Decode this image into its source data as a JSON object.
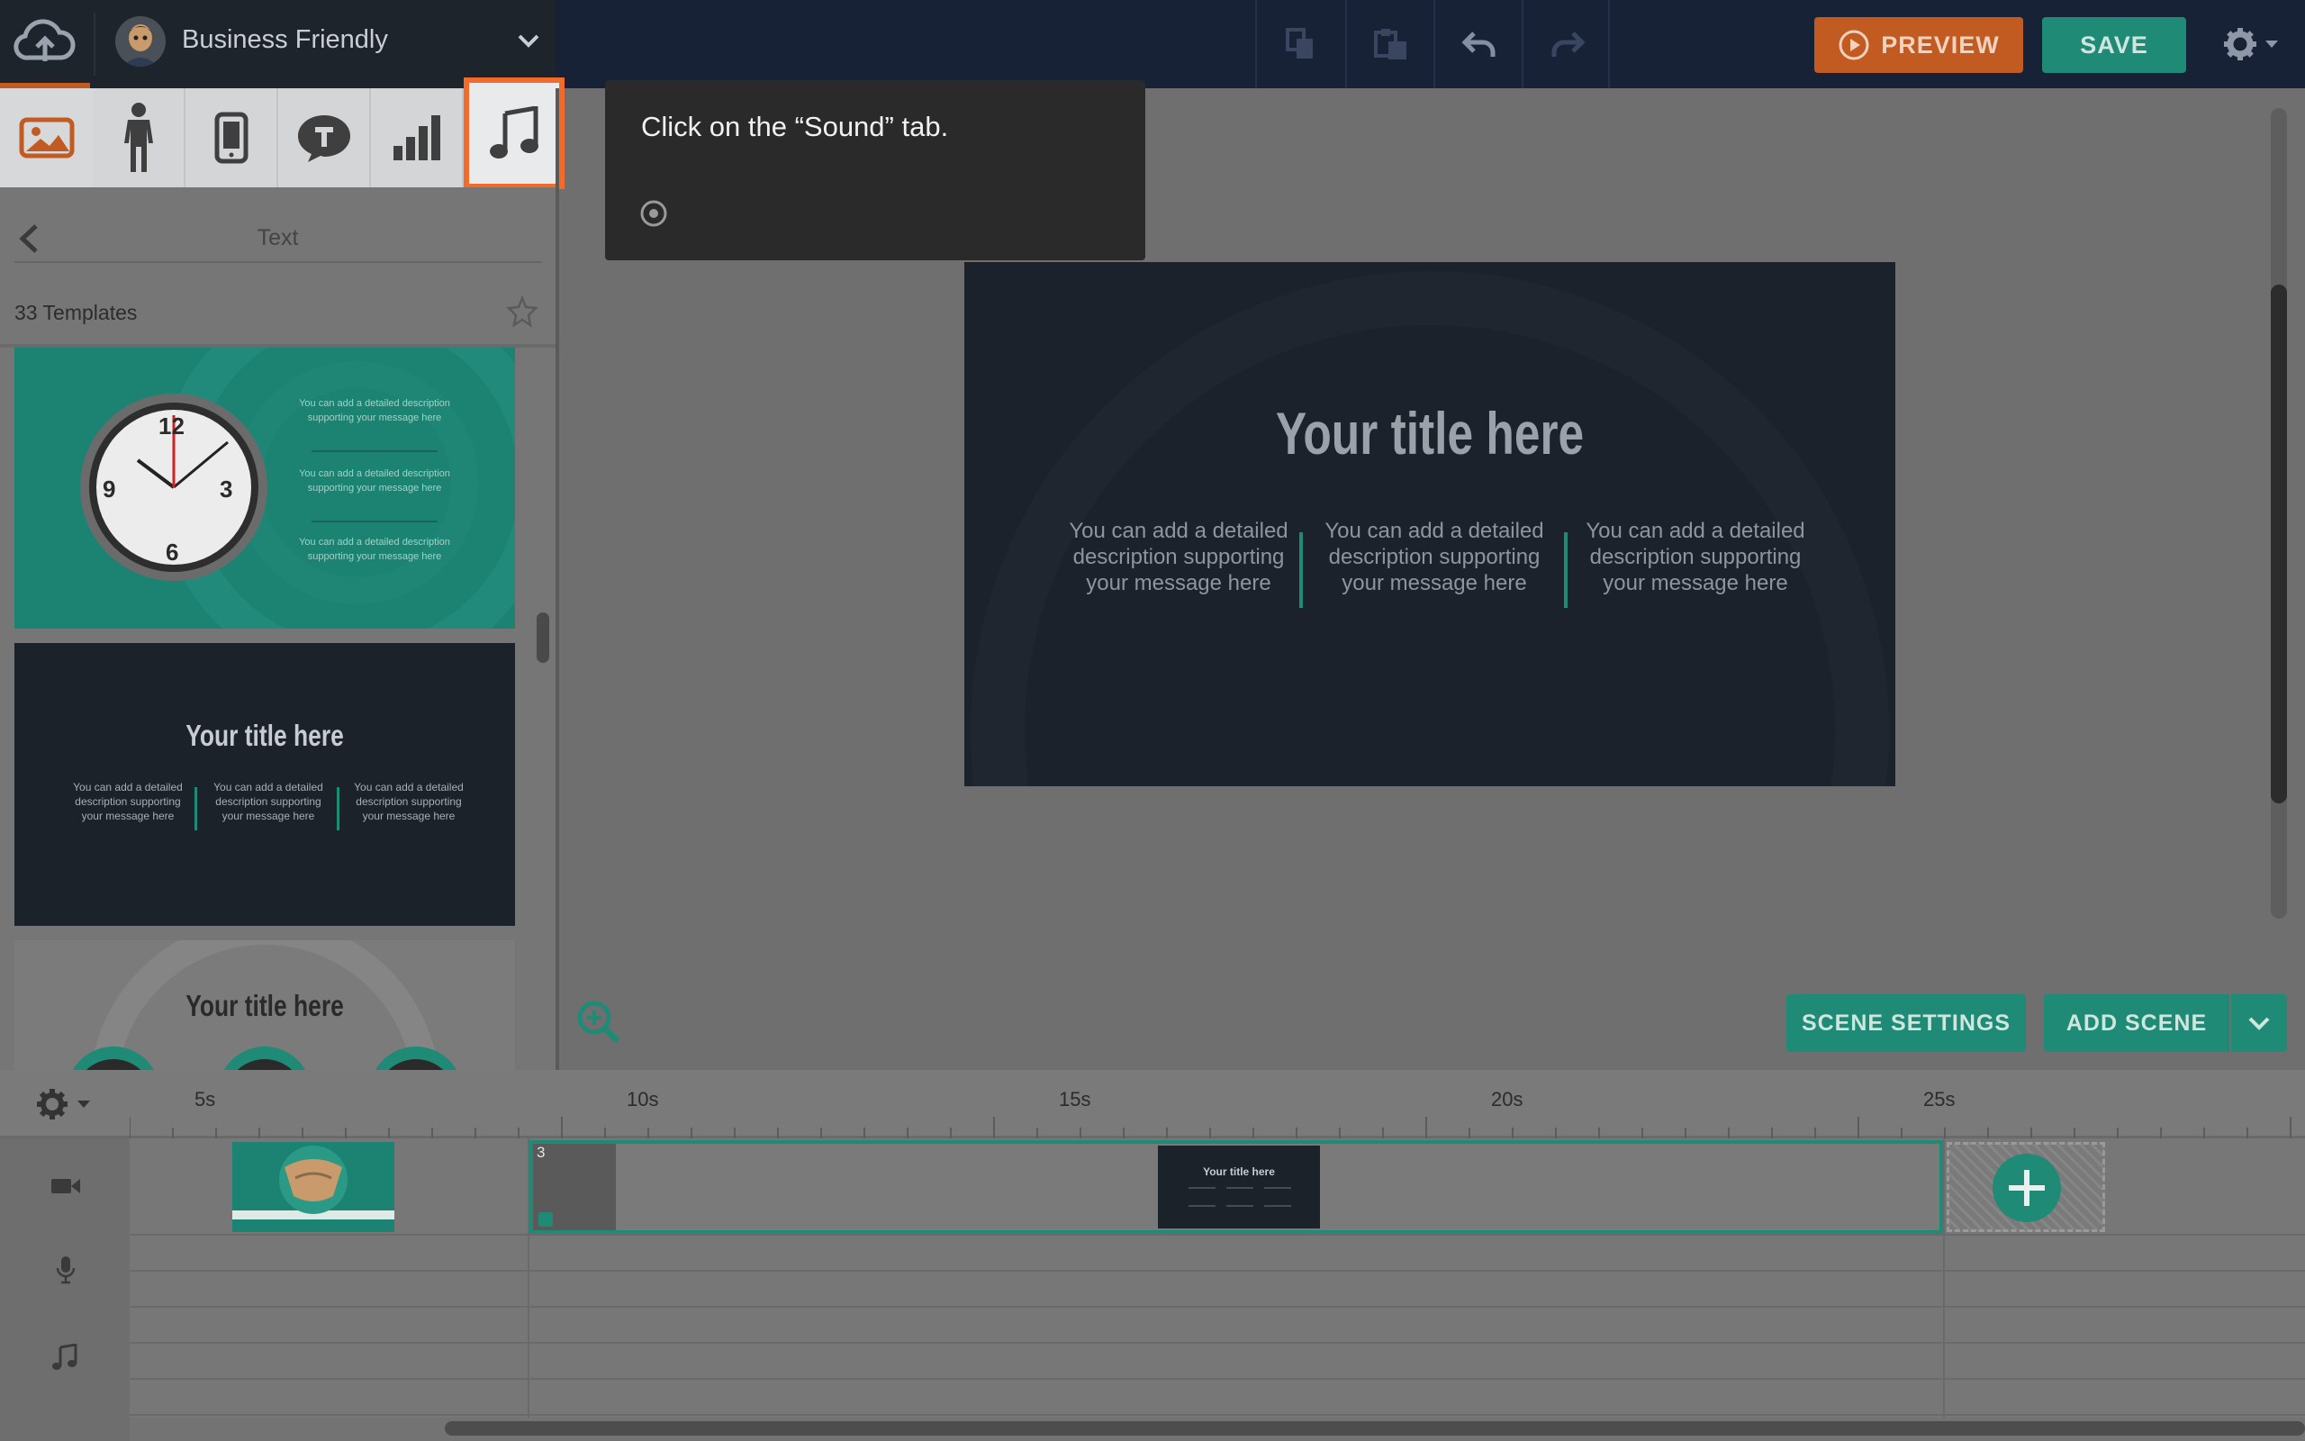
{
  "header": {
    "project_name": "Business Friendly",
    "preview_label": "PREVIEW",
    "save_label": "SAVE"
  },
  "panel": {
    "back_title": "Text",
    "template_count": "33 Templates"
  },
  "templates": [
    {
      "clock_numbers": [
        "12",
        "3",
        "6",
        "9"
      ],
      "descriptions": [
        "You can add a detailed description supporting your message here",
        "You can add a detailed description supporting your message here",
        "You can add a detailed description supporting your message here"
      ]
    },
    {
      "title": "Your title here",
      "descriptions": [
        "You can add a detailed description supporting your message here",
        "You can add a detailed description supporting your message here",
        "You can add a detailed description supporting your message here"
      ]
    },
    {
      "title": "Your title here"
    }
  ],
  "tooltip": {
    "text": "Click on the “Sound” tab."
  },
  "stage": {
    "title": "Your title here",
    "descriptions": [
      "You can add a detailed description supporting your message here",
      "You can add a detailed description supporting your message here",
      "You can add a detailed description supporting your message here"
    ]
  },
  "actions": {
    "scene_settings_label": "SCENE SETTINGS",
    "add_scene_label": "ADD SCENE"
  },
  "timeline": {
    "ticks": [
      "5s",
      "10s",
      "15s",
      "20s",
      "25s"
    ],
    "scene_number": "3",
    "mini_title": "Your title here"
  },
  "colors": {
    "accent_teal": "#1f8a76",
    "preview_orange": "#c25b22",
    "highlight_orange": "#f26b2a",
    "topbar_navy": "#172236"
  },
  "icons": {
    "sound_tab": "music-note-icon",
    "chart_tab": "bar-chart-icon",
    "text_tab": "speech-bubble-icon",
    "device_tab": "phone-icon",
    "character_tab": "person-icon",
    "image_tab": "picture-icon"
  }
}
